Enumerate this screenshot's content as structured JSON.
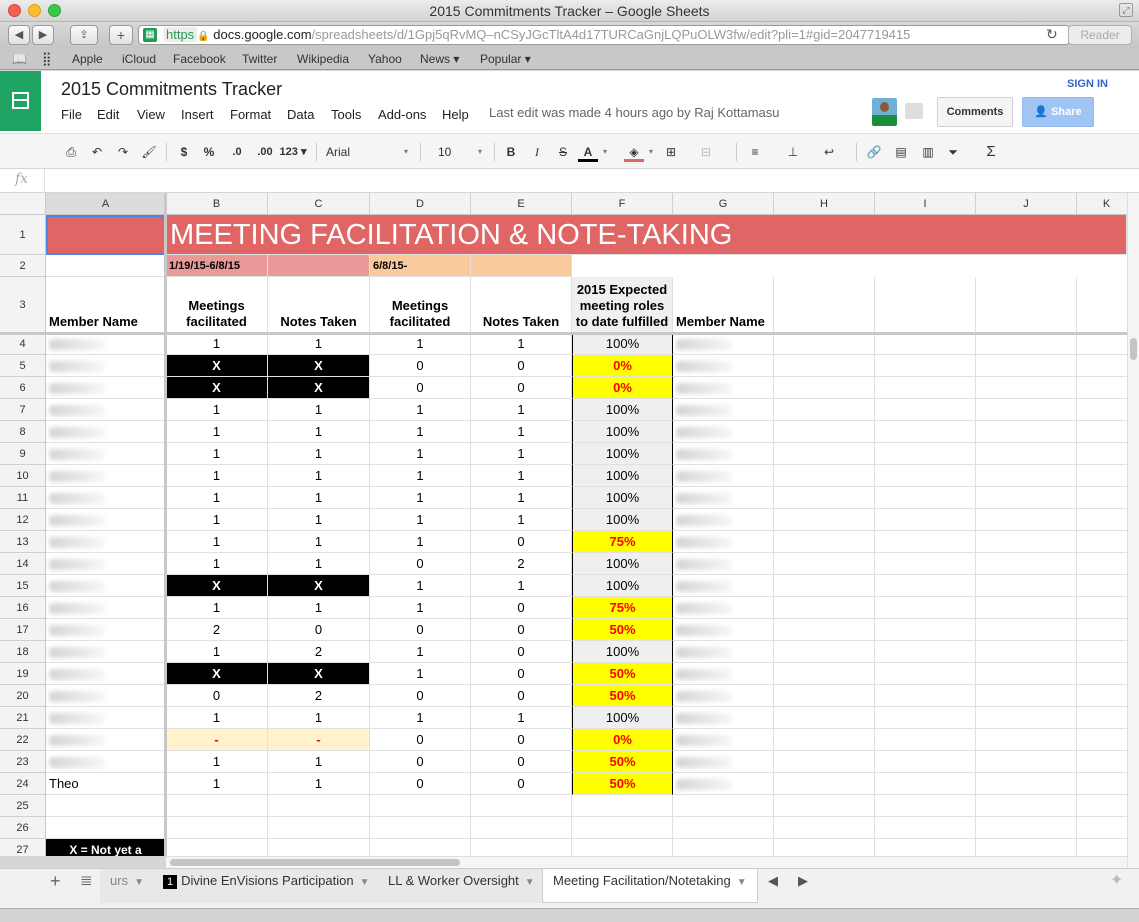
{
  "window": {
    "title": "2015 Commitments Tracker – Google Sheets"
  },
  "browser": {
    "url_scheme": "https",
    "url_host": "docs.google.com",
    "url_path": "/spreadsheets/d/1Gpj5qRvMQ–nCSyJGcTltA4d17TURCaGnjLQPuOLW3fw/edit?pli=1#gid=2047719415",
    "reader_label": "Reader",
    "bookmarks": [
      "Apple",
      "iCloud",
      "Facebook",
      "Twitter",
      "Wikipedia",
      "Yahoo",
      "News ▾",
      "Popular ▾"
    ]
  },
  "doc": {
    "title": "2015 Commitments Tracker",
    "menu": [
      "File",
      "Edit",
      "View",
      "Insert",
      "Format",
      "Data",
      "Tools",
      "Add-ons",
      "Help"
    ],
    "last_edit": "Last edit was made 4 hours ago by Raj Kottamasu",
    "sign_in": "SIGN IN",
    "comments_label": "Comments",
    "share_label": "Share"
  },
  "toolbar": {
    "currency": "$",
    "percent": "%",
    "dec_less": ".0",
    "dec_more": ".00",
    "more_formats": "123 ▾",
    "font": "Arial",
    "font_size": "10",
    "bold": "B",
    "italic": "I",
    "strike": "S",
    "text_color": "A",
    "sum": "Σ"
  },
  "formula": {
    "fx": "fx"
  },
  "columns": [
    "A",
    "B",
    "C",
    "D",
    "E",
    "F",
    "G",
    "H",
    "I",
    "J",
    "K"
  ],
  "sheet": {
    "banner": "MEETING FACILITATION & NOTE-TAKING",
    "period1": "1/19/15-6/8/15",
    "period2": "6/8/15-",
    "headers": {
      "member_name": "Member Name",
      "meetings_facilitated": "Meetings facilitated",
      "notes_taken": "Notes Taken",
      "expected": "2015 Expected meeting roles to date fulfilled",
      "member_name_2": "Member Name"
    },
    "rows": [
      {
        "n": "4",
        "a": "",
        "b": "1",
        "c": "1",
        "d": "1",
        "e": "1",
        "f": "100%"
      },
      {
        "n": "5",
        "a": "",
        "b": "X",
        "c": "X",
        "d": "0",
        "e": "0",
        "f": "0%"
      },
      {
        "n": "6",
        "a": "",
        "b": "X",
        "c": "X",
        "d": "0",
        "e": "0",
        "f": "0%"
      },
      {
        "n": "7",
        "a": "",
        "b": "1",
        "c": "1",
        "d": "1",
        "e": "1",
        "f": "100%"
      },
      {
        "n": "8",
        "a": "",
        "b": "1",
        "c": "1",
        "d": "1",
        "e": "1",
        "f": "100%"
      },
      {
        "n": "9",
        "a": "",
        "b": "1",
        "c": "1",
        "d": "1",
        "e": "1",
        "f": "100%"
      },
      {
        "n": "10",
        "a": "",
        "b": "1",
        "c": "1",
        "d": "1",
        "e": "1",
        "f": "100%"
      },
      {
        "n": "11",
        "a": "",
        "b": "1",
        "c": "1",
        "d": "1",
        "e": "1",
        "f": "100%"
      },
      {
        "n": "12",
        "a": "",
        "b": "1",
        "c": "1",
        "d": "1",
        "e": "1",
        "f": "100%"
      },
      {
        "n": "13",
        "a": "",
        "b": "1",
        "c": "1",
        "d": "1",
        "e": "0",
        "f": "75%"
      },
      {
        "n": "14",
        "a": "",
        "b": "1",
        "c": "1",
        "d": "0",
        "e": "2",
        "f": "100%"
      },
      {
        "n": "15",
        "a": "",
        "b": "X",
        "c": "X",
        "d": "1",
        "e": "1",
        "f": "100%"
      },
      {
        "n": "16",
        "a": "",
        "b": "1",
        "c": "1",
        "d": "1",
        "e": "0",
        "f": "75%"
      },
      {
        "n": "17",
        "a": "",
        "b": "2",
        "c": "0",
        "d": "0",
        "e": "0",
        "f": "50%"
      },
      {
        "n": "18",
        "a": "",
        "b": "1",
        "c": "2",
        "d": "1",
        "e": "0",
        "f": "100%"
      },
      {
        "n": "19",
        "a": "",
        "b": "X",
        "c": "X",
        "d": "1",
        "e": "0",
        "f": "50%"
      },
      {
        "n": "20",
        "a": "",
        "b": "0",
        "c": "2",
        "d": "0",
        "e": "0",
        "f": "50%"
      },
      {
        "n": "21",
        "a": "",
        "b": "1",
        "c": "1",
        "d": "1",
        "e": "1",
        "f": "100%"
      },
      {
        "n": "22",
        "a": "",
        "b": "-",
        "c": "-",
        "d": "0",
        "e": "0",
        "f": "0%"
      },
      {
        "n": "23",
        "a": "",
        "b": "1",
        "c": "1",
        "d": "0",
        "e": "0",
        "f": "50%"
      },
      {
        "n": "24",
        "a": "Theo",
        "b": "1",
        "c": "1",
        "d": "0",
        "e": "0",
        "f": "50%"
      }
    ],
    "extra_rows": [
      "25",
      "26",
      "27"
    ],
    "legend_x": "X = Not yet a"
  },
  "tabs": {
    "partial": "urs",
    "items": [
      {
        "badge": "1",
        "label": "Divine EnVisions Participation"
      },
      {
        "label": "LL & Worker Oversight"
      },
      {
        "label": "Meeting Facilitation/Notetaking"
      }
    ]
  },
  "colors": {
    "banner_red": "#e06666",
    "period1_bg": "#ea9999",
    "period2_bg": "#f9cb9c",
    "yellow": "#ffff00",
    "grey_f": "#efefef",
    "dash_bg": "#fff2cc",
    "red_text": "#ff0000"
  }
}
